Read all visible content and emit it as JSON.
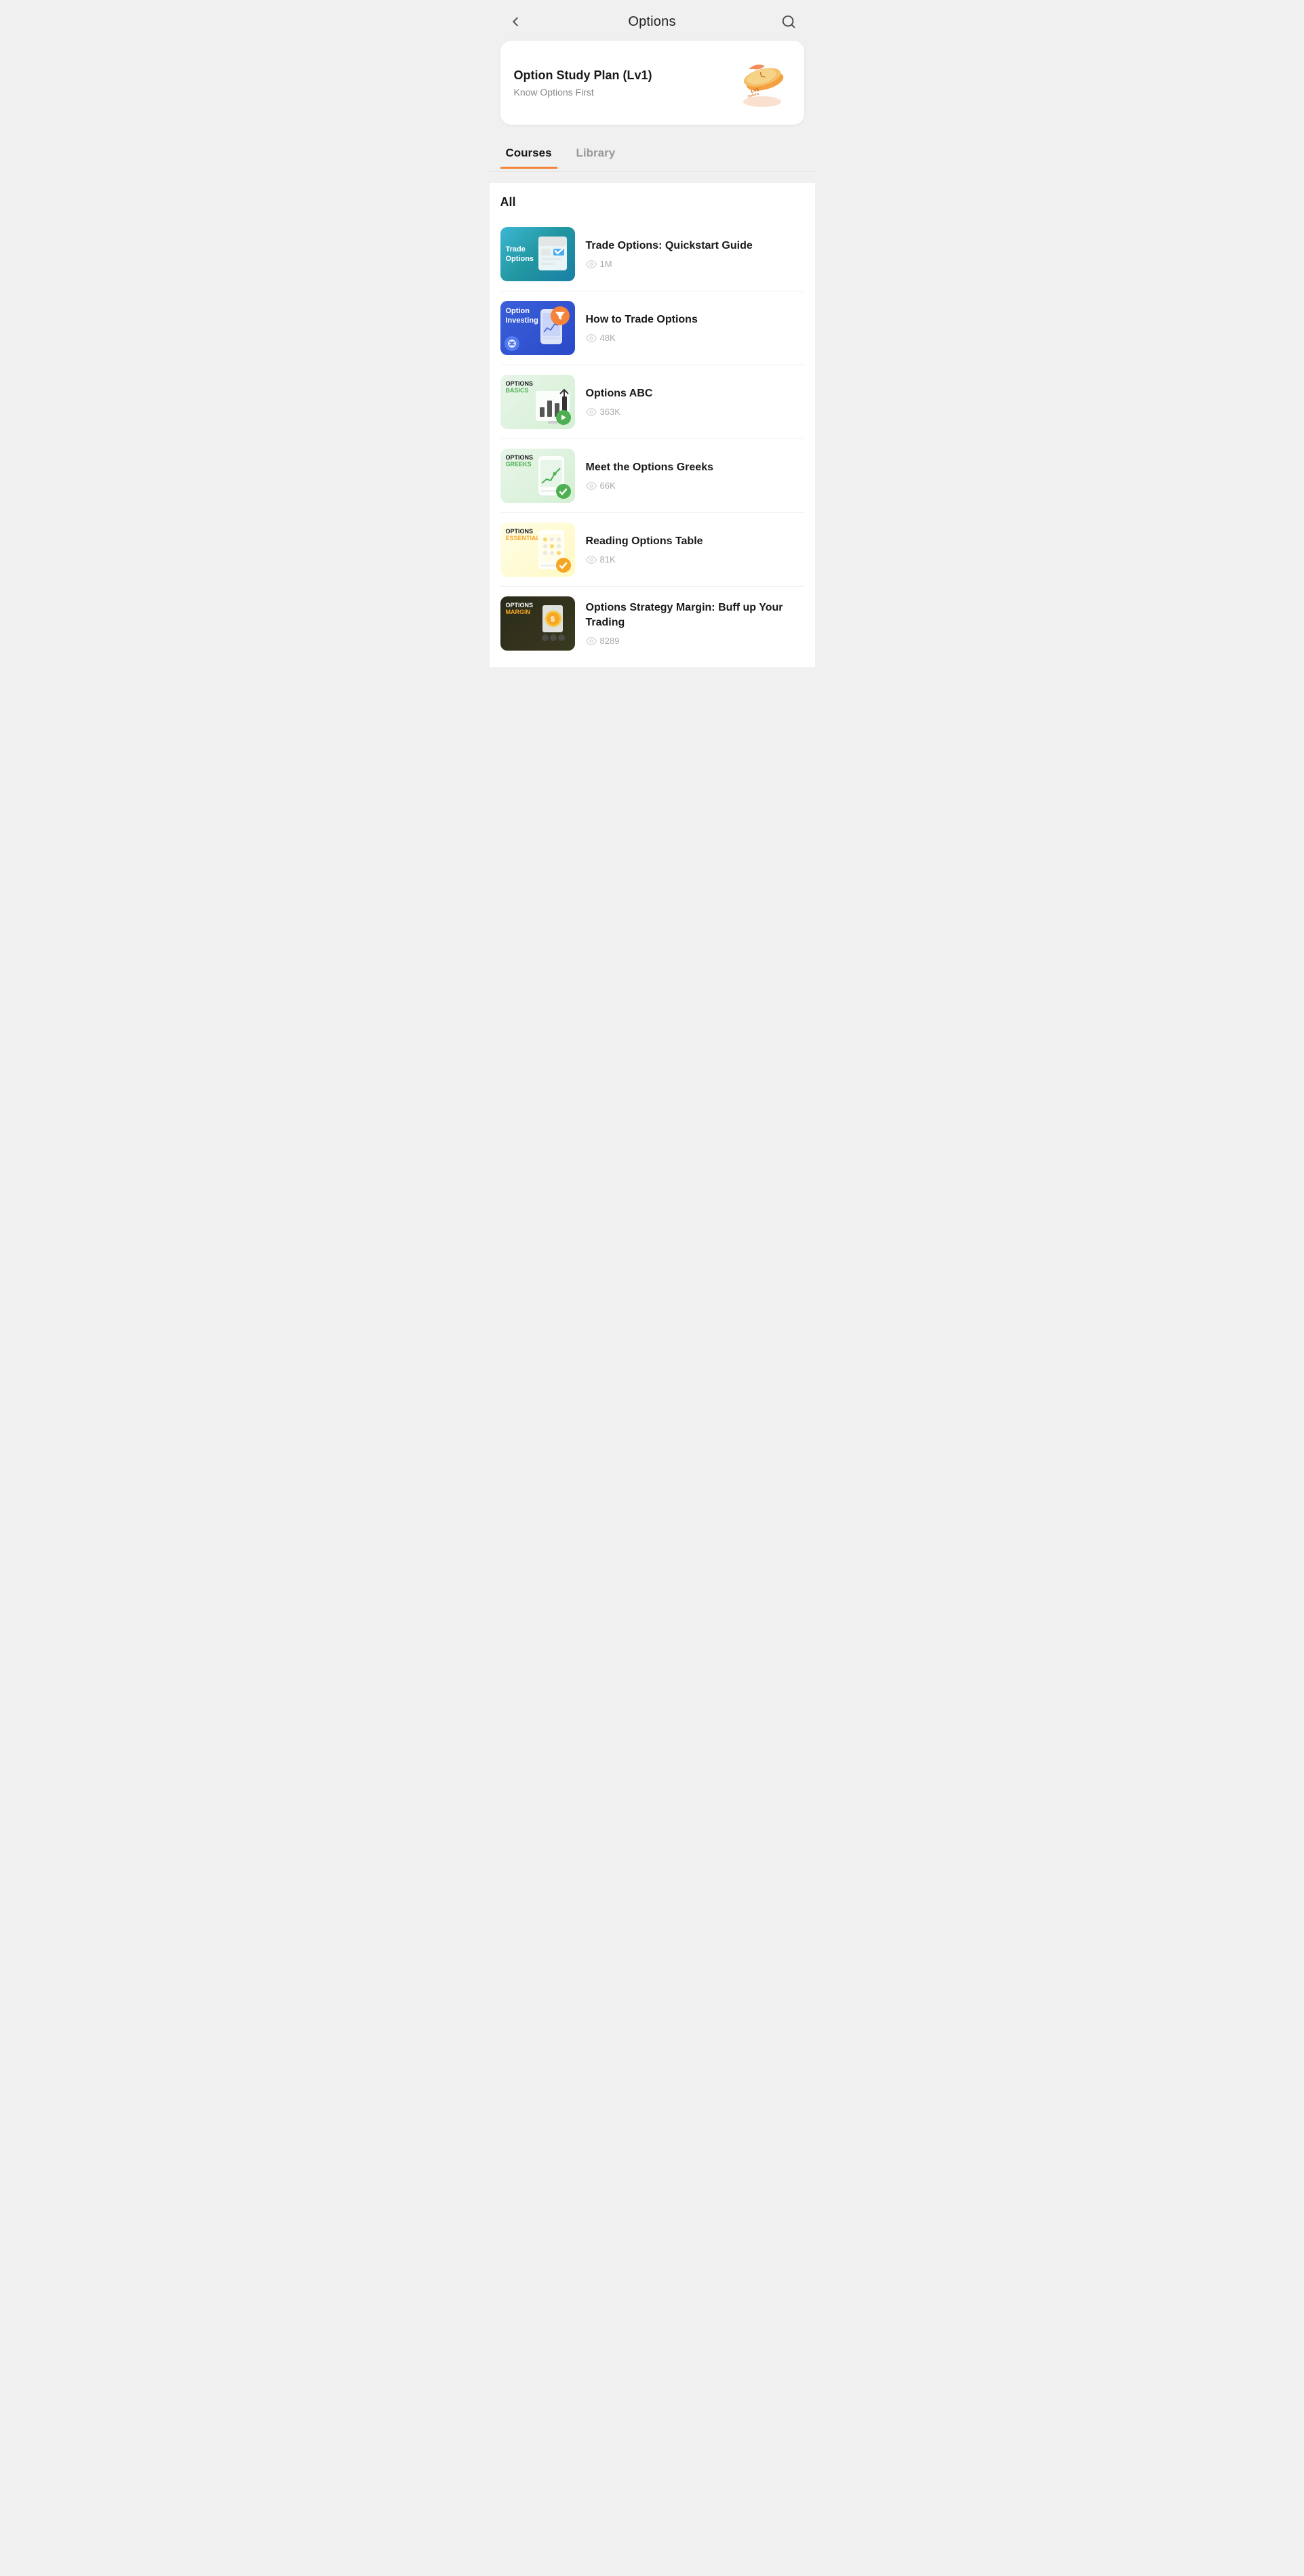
{
  "header": {
    "title": "Options",
    "back_label": "back",
    "search_label": "search"
  },
  "study_plan": {
    "title": "Option Study Plan (Lv1)",
    "subtitle": "Know Options First"
  },
  "tabs": [
    {
      "id": "courses",
      "label": "Courses",
      "active": true
    },
    {
      "id": "library",
      "label": "Library",
      "active": false
    }
  ],
  "section_title": "All",
  "courses": [
    {
      "id": 1,
      "title": "Trade Options: Quickstart Guide",
      "views": "1M",
      "thumb_type": "trade-options",
      "thumb_label_top": "Trade",
      "thumb_label_bot": "Options",
      "has_badge": false
    },
    {
      "id": 2,
      "title": "How to Trade Options",
      "views": "48K",
      "thumb_type": "option-investing",
      "thumb_label_top": "Option",
      "thumb_label_bot": "Investing",
      "has_badge": true,
      "badge_type": "funnel"
    },
    {
      "id": 3,
      "title": "Options ABC",
      "views": "363K",
      "thumb_type": "options-basics",
      "thumb_label_top": "OPTIONS",
      "thumb_label_bot": "BASICS",
      "has_badge": true,
      "badge_type": "play"
    },
    {
      "id": 4,
      "title": "Meet the Options Greeks",
      "views": "66K",
      "thumb_type": "options-greeks",
      "thumb_label_top": "OPTIONS",
      "thumb_label_bot": "GREEKS",
      "has_badge": true,
      "badge_type": "check"
    },
    {
      "id": 5,
      "title": "Reading Options Table",
      "views": "81K",
      "thumb_type": "options-essentials",
      "thumb_label_top": "OPTIONS",
      "thumb_label_bot": "ESSENTIALS",
      "has_badge": true,
      "badge_type": "check-orange"
    },
    {
      "id": 6,
      "title": "Options Strategy Margin: Buff up Your Trading",
      "views": "8289",
      "thumb_type": "options-margin",
      "thumb_label_top": "OPTIONS",
      "thumb_label_bot": "MARGIN",
      "has_badge": false
    }
  ]
}
